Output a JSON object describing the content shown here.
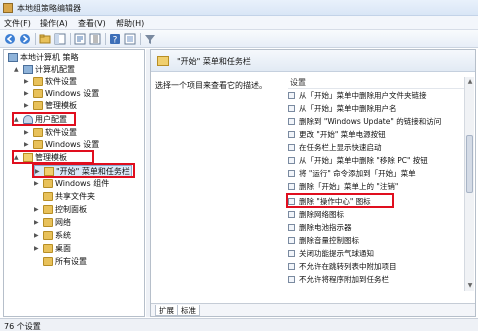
{
  "window": {
    "title": "本地组策略编辑器"
  },
  "menubar": [
    "文件(F)",
    "操作(A)",
    "查看(V)",
    "帮助(H)"
  ],
  "toolbar": {
    "icons": [
      "back-icon",
      "forward-icon",
      "up-folder-icon",
      "show-hide-tree-icon",
      "refresh-icon",
      "export-icon",
      "help-icon",
      "properties-icon",
      "filter-icon"
    ]
  },
  "tree": [
    {
      "label": "本地计算机 策略",
      "icon": "policy",
      "twisty": ""
    },
    {
      "label": "计算机配置",
      "icon": "pc",
      "twisty": "▲"
    },
    {
      "label": "软件设置",
      "icon": "folder",
      "twisty": "▶"
    },
    {
      "label": "Windows 设置",
      "icon": "folder",
      "twisty": "▶"
    },
    {
      "label": "管理模板",
      "icon": "folder",
      "twisty": "▶"
    },
    {
      "label": "用户配置",
      "icon": "user",
      "twisty": "▲"
    },
    {
      "label": "软件设置",
      "icon": "folder",
      "twisty": "▶"
    },
    {
      "label": "Windows 设置",
      "icon": "folder",
      "twisty": "▶"
    },
    {
      "label": "管理模板",
      "icon": "folder-open",
      "twisty": "▲"
    },
    {
      "label": "\"开始\" 菜单和任务栏",
      "icon": "folder-open",
      "twisty": "▶"
    },
    {
      "label": "Windows 组件",
      "icon": "folder",
      "twisty": "▶"
    },
    {
      "label": "共享文件夹",
      "icon": "folder",
      "twisty": ""
    },
    {
      "label": "控制面板",
      "icon": "folder",
      "twisty": "▶"
    },
    {
      "label": "网络",
      "icon": "folder",
      "twisty": "▶"
    },
    {
      "label": "系统",
      "icon": "folder",
      "twisty": "▶"
    },
    {
      "label": "桌面",
      "icon": "folder",
      "twisty": "▶"
    },
    {
      "label": "所有设置",
      "icon": "folder",
      "twisty": ""
    }
  ],
  "right": {
    "header": "\"开始\" 菜单和任务栏",
    "description": "选择一个项目来查看它的描述。",
    "column": "设置",
    "settings": [
      "从「开始」菜单中删除用户文件夹链接",
      "从「开始」菜单中删除用户名",
      "删除到 \"Windows Update\" 的链接和访问",
      "更改 \"开始\" 菜单电源按钮",
      "在任务栏上显示快速启动",
      "从「开始」菜单中删除 \"移除 PC\" 按钮",
      "将 \"运行\" 命令添加到「开始」菜单",
      "删除「开始」菜单上的 \"注销\"",
      "删除 \"操作中心\" 图标",
      "删除网络图标",
      "删除电池指示器",
      "删除音量控制图标",
      "关闭功能提示气球通知",
      "不允许在跳转列表中附加项目",
      "不允许将程序附加到任务栏"
    ]
  },
  "tabs": [
    "扩展",
    "标准"
  ],
  "status": "76 个设置"
}
